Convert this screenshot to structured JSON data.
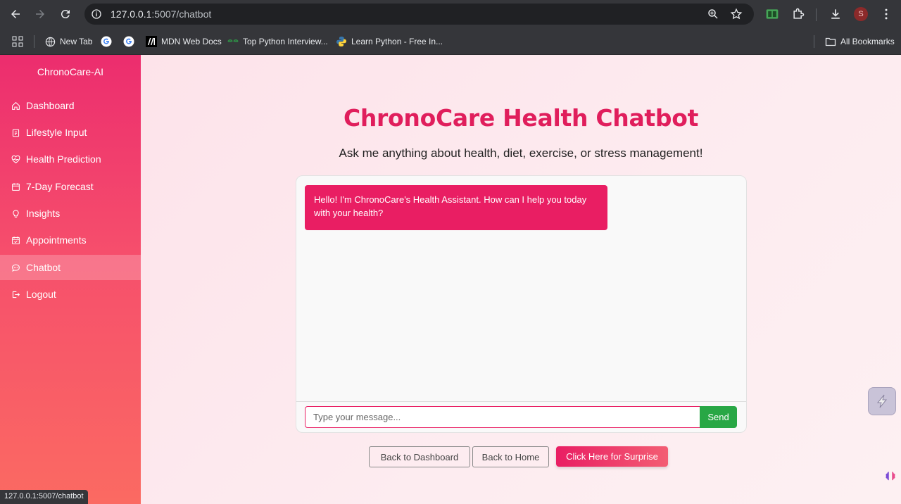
{
  "browser": {
    "url_host": "127.0.0.1",
    "url_path": ":5007/chatbot",
    "status_url": "127.0.0.1:5007/chatbot",
    "profile_initial": "S",
    "bookmarks": [
      {
        "label": "New Tab",
        "icon": "globe-icon"
      },
      {
        "label": "",
        "icon": "google-icon"
      },
      {
        "label": "",
        "icon": "google-icon"
      },
      {
        "label": "MDN Web Docs",
        "icon": "mdn-icon"
      },
      {
        "label": "Top Python Interview...",
        "icon": "gfg-icon"
      },
      {
        "label": "Learn Python - Free In...",
        "icon": "python-icon"
      }
    ],
    "all_bookmarks": "All Bookmarks"
  },
  "sidebar": {
    "brand": "ChronoCare-AI",
    "items": [
      {
        "label": "Dashboard",
        "icon": "home-icon"
      },
      {
        "label": "Lifestyle Input",
        "icon": "clipboard-icon"
      },
      {
        "label": "Health Prediction",
        "icon": "heart-pulse-icon"
      },
      {
        "label": "7-Day Forecast",
        "icon": "calendar-icon"
      },
      {
        "label": "Insights",
        "icon": "lightbulb-icon"
      },
      {
        "label": "Appointments",
        "icon": "calendar-check-icon"
      },
      {
        "label": "Chatbot",
        "icon": "chat-icon",
        "active": true
      },
      {
        "label": "Logout",
        "icon": "logout-icon"
      }
    ]
  },
  "main": {
    "title": "ChronoCare Health Chatbot",
    "subtitle": "Ask me anything about health, diet, exercise, or stress management!",
    "bot_message": "Hello! I'm ChronoCare's Health Assistant. How can I help you today with your health?",
    "input_placeholder": "Type your message...",
    "send_label": "Send",
    "back_dashboard_label": "Back to Dashboard",
    "back_home_label": "Back to Home",
    "surprise_label": "Click Here for Surprise"
  },
  "colors": {
    "accent": "#e91e63",
    "send_green": "#28a745",
    "page_bg": "#fde6ec"
  }
}
